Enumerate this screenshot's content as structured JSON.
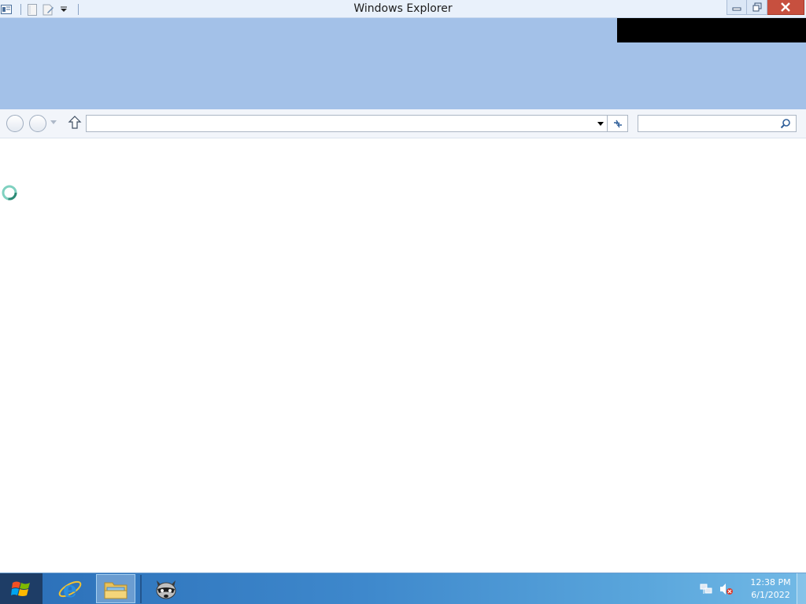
{
  "window": {
    "title": "Windows Explorer"
  },
  "quick_access": {
    "icons": [
      "properties-icon",
      "new-folder-icon",
      "rename-icon",
      "customize-dropdown-icon"
    ]
  },
  "navigation": {
    "address_value": "",
    "search_placeholder": ""
  },
  "content": {
    "loading_icon": "spinner-icon"
  },
  "taskbar": {
    "apps": [
      "internet-explorer",
      "file-explorer",
      "raccoon-app"
    ],
    "active_app": "file-explorer",
    "clock_time": "12:38 PM",
    "clock_date": "6/1/2022"
  },
  "colors": {
    "ribbon": "#a3c1e8",
    "taskbar": "#3e88cc",
    "close_button": "#c7503f"
  }
}
